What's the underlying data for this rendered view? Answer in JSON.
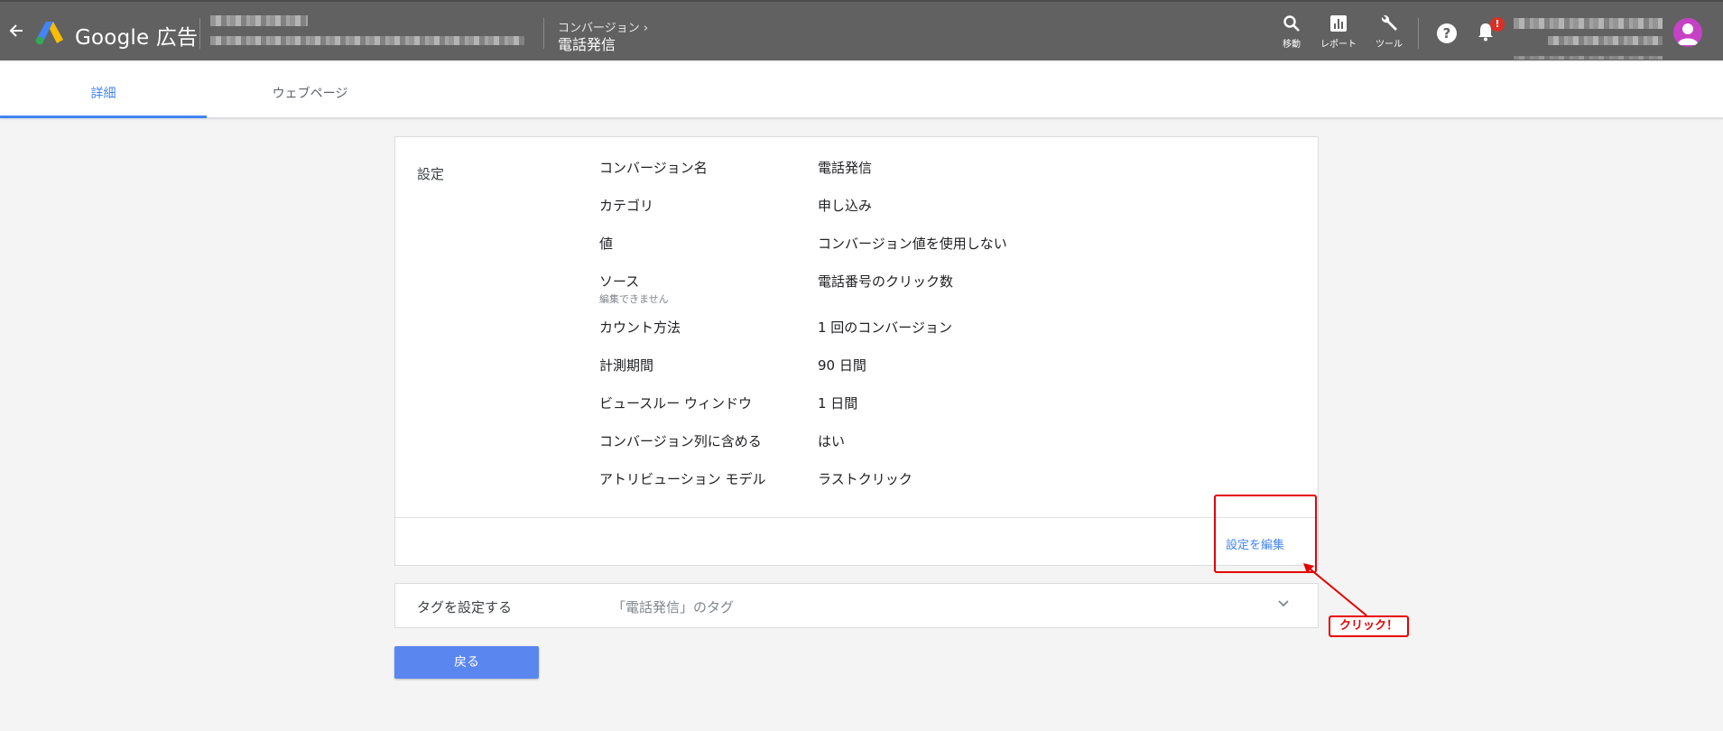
{
  "header": {
    "brand": "Google 広告",
    "breadcrumb_parent": "コンバージョン",
    "breadcrumb_separator": "›",
    "breadcrumb_current": "電話発信",
    "tools": [
      {
        "label": "移動",
        "icon": "search-icon"
      },
      {
        "label": "レポート",
        "icon": "report-icon"
      },
      {
        "label": "ツール",
        "icon": "wrench-icon"
      }
    ],
    "help_glyph": "?",
    "notification_badge": "!"
  },
  "tabs": [
    {
      "label": "詳細",
      "active": true
    },
    {
      "label": "ウェブページ",
      "active": false
    }
  ],
  "settings": {
    "section_label": "設定",
    "rows": [
      {
        "label": "コンバージョン名",
        "value": "電話発信"
      },
      {
        "label": "カテゴリ",
        "value": "申し込み"
      },
      {
        "label": "値",
        "value": "コンバージョン値を使用しない"
      },
      {
        "label": "ソース",
        "sublabel": "編集できません",
        "value": "電話番号のクリック数"
      },
      {
        "label": "カウント方法",
        "value": "1 回のコンバージョン"
      },
      {
        "label": "計測期間",
        "value": "90 日間"
      },
      {
        "label": "ビュースルー ウィンドウ",
        "value": "1 日間"
      },
      {
        "label": "コンバージョン列に含める",
        "value": "はい"
      },
      {
        "label": "アトリビューション モデル",
        "value": "ラストクリック"
      }
    ],
    "edit_link": "設定を編集"
  },
  "tag_setup": {
    "label": "タグを設定する",
    "value": "「電話発信」のタグ"
  },
  "back_button": "戻る",
  "annotation": {
    "label": "クリック！",
    "color": "#e60000"
  },
  "colors": {
    "header_bg": "#616161",
    "accent": "#4285f4",
    "button": "#5a86ef"
  }
}
